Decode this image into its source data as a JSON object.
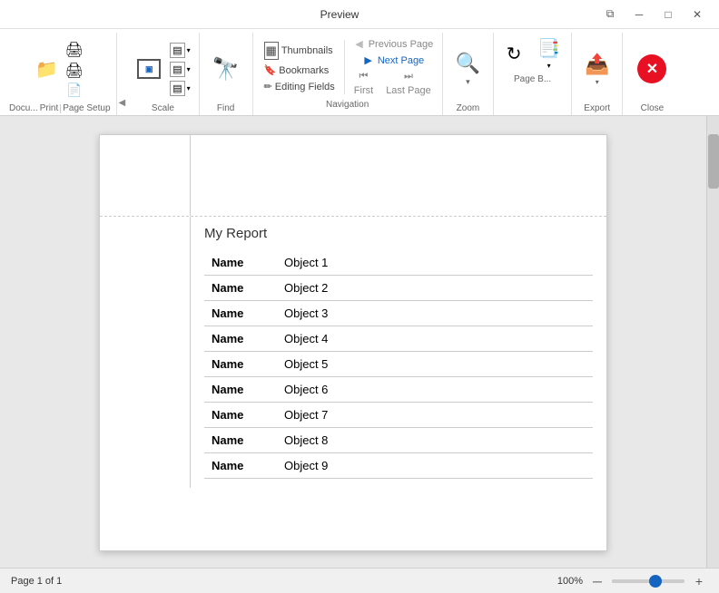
{
  "window": {
    "title": "Preview",
    "controls": {
      "restore": "❐",
      "minimize": "─",
      "maximize": "□",
      "close": "✕"
    }
  },
  "toolbar": {
    "groups": {
      "document": {
        "label": "Docu...",
        "icon": "📄",
        "buttons": [
          {
            "label": "📄",
            "name": "doc-icon"
          },
          {
            "label": "🖨",
            "name": "print-icon-top"
          },
          {
            "label": "🖨",
            "name": "print-icon-bottom"
          },
          {
            "label": "📄",
            "name": "page-icon"
          }
        ]
      },
      "print": {
        "label": "Print"
      },
      "pagesetup": {
        "label": "Page Setup"
      },
      "find": {
        "label": "Find",
        "icon": "🔭"
      },
      "navigation": {
        "label": "Navigation",
        "thumbnails": "Thumbnails",
        "bookmarks": "Bookmarks",
        "editingFields": "Editing Fields",
        "previousPage": "Previous Page",
        "nextPage": "Next Page",
        "firstPage": "First",
        "lastPage": "Last Page"
      },
      "zoom": {
        "label": "Zoom",
        "icon": "🔍"
      },
      "pageB": {
        "label": "Page B...",
        "icon": "📑"
      },
      "export": {
        "label": "Export",
        "icon": "📤"
      },
      "close": {
        "label": "Close",
        "icon": "✕"
      }
    }
  },
  "navigation_labels": {
    "thumbnails": "Thumbnails",
    "bookmarks": "Bookmarks",
    "editing_fields": "Editing Fields",
    "previous_page": "Previous Page",
    "next_page": "Next Page",
    "first": "First",
    "last_page": "Last Page"
  },
  "report": {
    "title": "My Report",
    "rows": [
      {
        "label": "Name",
        "value": "Object 1"
      },
      {
        "label": "Name",
        "value": "Object 2"
      },
      {
        "label": "Name",
        "value": "Object 3"
      },
      {
        "label": "Name",
        "value": "Object 4"
      },
      {
        "label": "Name",
        "value": "Object 5"
      },
      {
        "label": "Name",
        "value": "Object 6"
      },
      {
        "label": "Name",
        "value": "Object 7"
      },
      {
        "label": "Name",
        "value": "Object 8"
      },
      {
        "label": "Name",
        "value": "Object 9"
      }
    ]
  },
  "status": {
    "page_info": "Page 1 of 1",
    "zoom_level": "100%"
  }
}
